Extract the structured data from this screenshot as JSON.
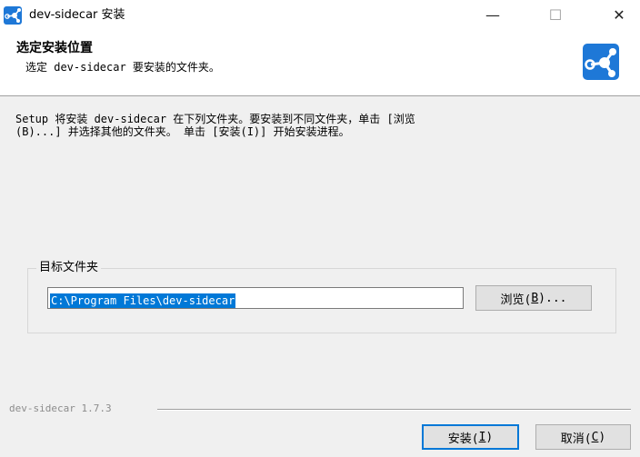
{
  "window": {
    "title": "dev-sidecar 安装",
    "minimize_glyph": "—",
    "maximize_glyph": "☐",
    "close_glyph": "✕",
    "app_icon": "dev-sidecar-logo-icon"
  },
  "header": {
    "title": "选定安装位置",
    "subtitle": "选定 dev-sidecar 要安装的文件夹。",
    "logo_icon": "dev-sidecar-logo-icon"
  },
  "intro": {
    "line1": "Setup 将安装 dev-sidecar 在下列文件夹。要安装到不同文件夹，单击 [浏览",
    "line2": "(B)...] 并选择其他的文件夹。 单击 [安装(I)] 开始安装进程。"
  },
  "destination": {
    "legend": "目标文件夹",
    "path": "C:\\Program Files\\dev-sidecar",
    "browse_prefix": "浏览(",
    "browse_key": "B",
    "browse_suffix": ")..."
  },
  "footer": {
    "brand": "dev-sidecar 1.7.3",
    "install_prefix": "安装(",
    "install_key": "I",
    "install_suffix": ")",
    "cancel_prefix": "取消(",
    "cancel_key": "C",
    "cancel_suffix": ")"
  },
  "colors": {
    "accent": "#0078d7",
    "logo_blue": "#1e78d7",
    "dialog_bg": "#f0f0f0"
  }
}
